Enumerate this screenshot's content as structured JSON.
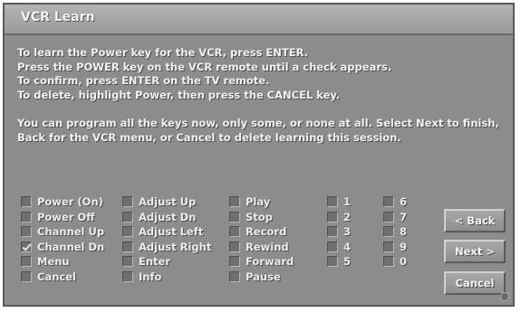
{
  "window": {
    "title": "VCR Learn"
  },
  "instructions": {
    "lines": [
      "To learn the Power key for the VCR, press ENTER.",
      "Press the POWER key on the VCR remote until a check appears.",
      "To confirm, press ENTER on the TV remote.",
      "To delete, highlight Power, then press the CANCEL key."
    ],
    "paragraph": "You can program all the keys now, only some, or none at all. Select Next to finish, Back for the VCR menu, or Cancel to delete learning this session."
  },
  "keys": {
    "col1": [
      {
        "label": "Power (On)",
        "checked": false
      },
      {
        "label": "Power Off",
        "checked": false
      },
      {
        "label": "Channel Up",
        "checked": false
      },
      {
        "label": "Channel Dn",
        "checked": true
      },
      {
        "label": "Menu",
        "checked": false
      },
      {
        "label": "Cancel",
        "checked": false
      }
    ],
    "col2": [
      {
        "label": "Adjust Up",
        "checked": false
      },
      {
        "label": "Adjust Dn",
        "checked": false
      },
      {
        "label": "Adjust Left",
        "checked": false
      },
      {
        "label": "Adjust Right",
        "checked": false
      },
      {
        "label": "Enter",
        "checked": false
      },
      {
        "label": "Info",
        "checked": false
      }
    ],
    "col3": [
      {
        "label": "Play",
        "checked": false
      },
      {
        "label": "Stop",
        "checked": false
      },
      {
        "label": "Record",
        "checked": false
      },
      {
        "label": "Rewind",
        "checked": false
      },
      {
        "label": "Forward",
        "checked": false
      },
      {
        "label": "Pause",
        "checked": false
      }
    ],
    "col4": [
      {
        "label": "1",
        "checked": false
      },
      {
        "label": "2",
        "checked": false
      },
      {
        "label": "3",
        "checked": false
      },
      {
        "label": "4",
        "checked": false
      },
      {
        "label": "5",
        "checked": false
      }
    ],
    "col5": [
      {
        "label": "6",
        "checked": false
      },
      {
        "label": "7",
        "checked": false
      },
      {
        "label": "8",
        "checked": false
      },
      {
        "label": "9",
        "checked": false
      },
      {
        "label": "0",
        "checked": false
      }
    ]
  },
  "buttons": {
    "back": "< Back",
    "next": "Next >",
    "cancel": "Cancel"
  }
}
